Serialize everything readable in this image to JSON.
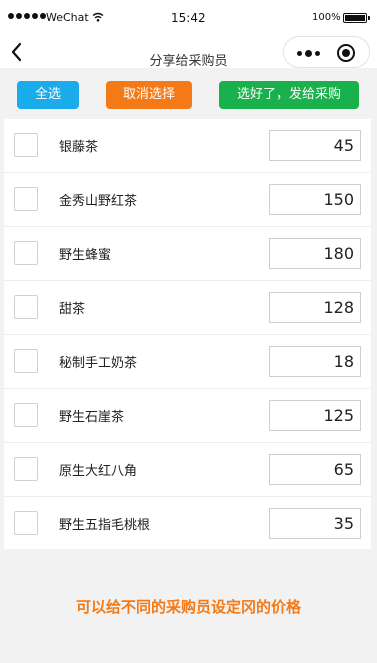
{
  "status_bar": {
    "carrier": "WeChat",
    "time": "15:42",
    "battery": "100%"
  },
  "nav": {
    "title": "分享给采购员"
  },
  "actions": {
    "select_all": "全选",
    "cancel_select": "取消选择",
    "send": "选好了，发给采购"
  },
  "products": [
    {
      "name": "银藤茶",
      "qty": "45"
    },
    {
      "name": "金秀山野红茶",
      "qty": "150"
    },
    {
      "name": "野生蜂蜜",
      "qty": "180"
    },
    {
      "name": "甜茶",
      "qty": "128"
    },
    {
      "name": "秘制手工奶茶",
      "qty": "18"
    },
    {
      "name": "野生石崖茶",
      "qty": "125"
    },
    {
      "name": "原生大红八角",
      "qty": "65"
    },
    {
      "name": "野生五指毛桃根",
      "qty": "35"
    }
  ],
  "note": "可以给不同的采购员设定冈的价格",
  "colors": {
    "select_all": "#1aabeb",
    "cancel": "#f47a17",
    "send": "#18b14c",
    "note": "#f47a17"
  },
  "icons": [
    "signal-icon",
    "wifi-icon",
    "battery-icon",
    "back-icon",
    "more-icon",
    "close-icon"
  ]
}
